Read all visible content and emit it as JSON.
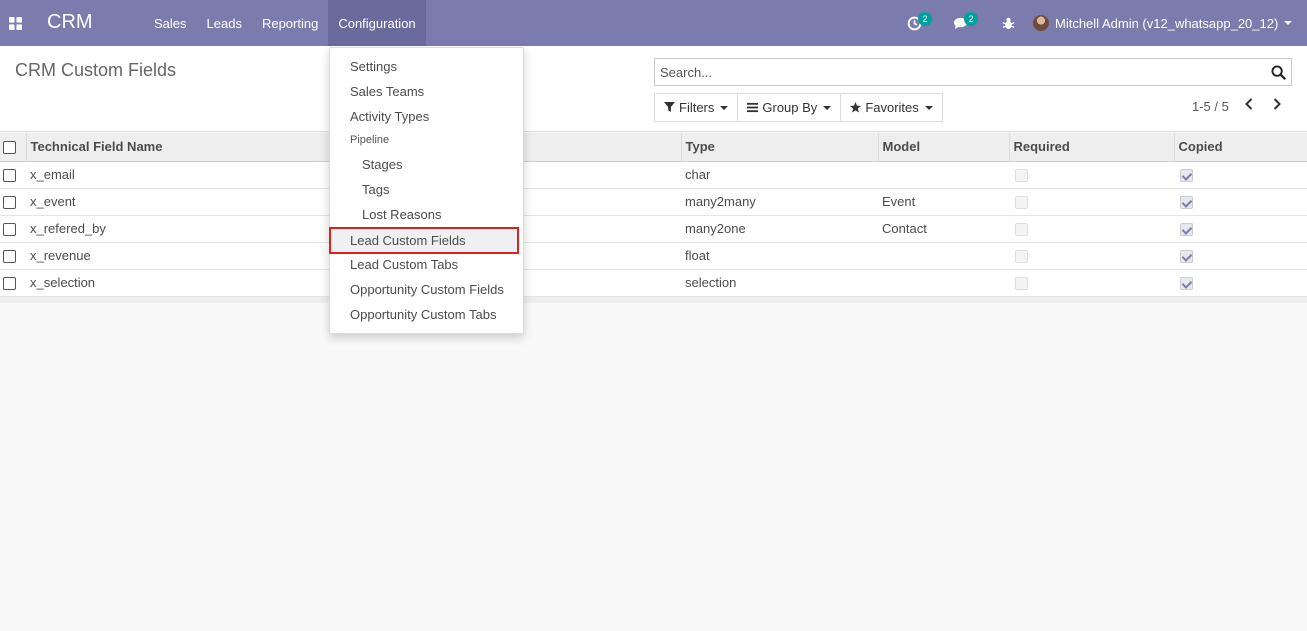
{
  "navbar": {
    "brand": "CRM",
    "menu": [
      "Sales",
      "Leads",
      "Reporting",
      "Configuration"
    ],
    "activities_badge": "2",
    "messages_badge": "2",
    "user": "Mitchell Admin (v12_whatsapp_20_12)"
  },
  "control_panel": {
    "title": "CRM Custom Fields",
    "search_placeholder": "Search...",
    "filters": "Filters",
    "group_by": "Group By",
    "favorites": "Favorites",
    "pager": "1-5 / 5"
  },
  "table": {
    "headers": [
      "Technical Field Name",
      "Type",
      "Model",
      "Required",
      "Copied"
    ],
    "rows": [
      {
        "name": "x_email",
        "type": "char",
        "model": ""
      },
      {
        "name": "x_event",
        "type": "many2many",
        "model": "Event"
      },
      {
        "name": "x_refered_by",
        "type": "many2one",
        "model": "Contact"
      },
      {
        "name": "x_revenue",
        "type": "float",
        "model": ""
      },
      {
        "name": "x_selection",
        "type": "selection",
        "model": ""
      }
    ]
  },
  "dropdown": {
    "settings": "Settings",
    "sales_teams": "Sales Teams",
    "activity_types": "Activity Types",
    "pipeline_header": "Pipeline",
    "stages": "Stages",
    "tags": "Tags",
    "lost_reasons": "Lost Reasons",
    "lead_custom_fields": "Lead Custom Fields",
    "lead_custom_tabs": "Lead Custom Tabs",
    "opportunity_custom_fields": "Opportunity Custom Fields",
    "opportunity_custom_tabs": "Opportunity Custom Tabs"
  },
  "colors": {
    "navbar": "#7c7bad",
    "navbar_active": "#6a6a9c",
    "badge": "#00a09d",
    "highlight_border": "#e02020"
  }
}
